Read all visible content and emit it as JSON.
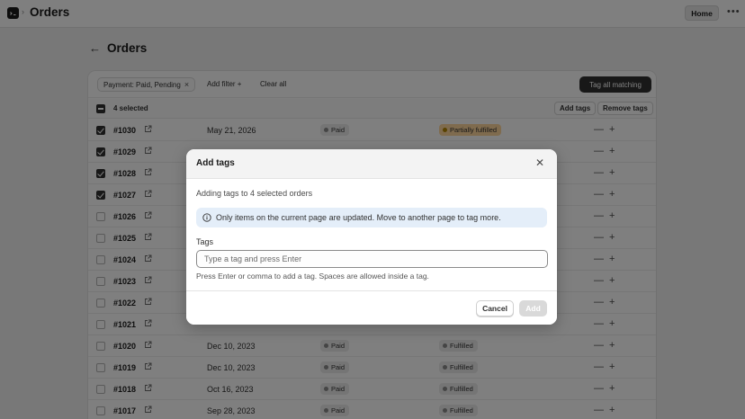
{
  "topbar": {
    "title": "Orders",
    "home_label": "Home",
    "more_icon": "more-horizontal-icon"
  },
  "page": {
    "title": "Orders"
  },
  "filters": {
    "chip_label": "Payment: Paid, Pending",
    "add_filter_label": "Add filter +",
    "clear_all_label": "Clear all",
    "tag_all_label": "Tag all matching"
  },
  "bulk": {
    "selected_label": "4 selected",
    "add_tags_label": "Add tags",
    "remove_tags_label": "Remove tags"
  },
  "orders": [
    {
      "number": "#1030",
      "date": "May 21, 2026",
      "payment": "Paid",
      "fulfillment": "Partially fulfilled",
      "checked": true,
      "partial": true
    },
    {
      "number": "#1029",
      "date": "",
      "payment": "",
      "fulfillment": "",
      "checked": true,
      "partial": true
    },
    {
      "number": "#1028",
      "date": "",
      "payment": "",
      "fulfillment": "",
      "checked": true,
      "partial": false
    },
    {
      "number": "#1027",
      "date": "",
      "payment": "",
      "fulfillment": "",
      "checked": true,
      "partial": false
    },
    {
      "number": "#1026",
      "date": "",
      "payment": "",
      "fulfillment": "",
      "checked": false,
      "partial": false
    },
    {
      "number": "#1025",
      "date": "",
      "payment": "",
      "fulfillment": "",
      "checked": false,
      "partial": false
    },
    {
      "number": "#1024",
      "date": "",
      "payment": "",
      "fulfillment": "",
      "checked": false,
      "partial": false
    },
    {
      "number": "#1023",
      "date": "",
      "payment": "",
      "fulfillment": "",
      "checked": false,
      "partial": false
    },
    {
      "number": "#1022",
      "date": "",
      "payment": "",
      "fulfillment": "",
      "checked": false,
      "partial": false
    },
    {
      "number": "#1021",
      "date": "",
      "payment": "",
      "fulfillment": "",
      "checked": false,
      "partial": false
    },
    {
      "number": "#1020",
      "date": "Dec 10, 2023",
      "payment": "Paid",
      "fulfillment": "Fulfilled",
      "checked": false,
      "partial": false
    },
    {
      "number": "#1019",
      "date": "Dec 10, 2023",
      "payment": "Paid",
      "fulfillment": "Fulfilled",
      "checked": false,
      "partial": false
    },
    {
      "number": "#1018",
      "date": "Oct 16, 2023",
      "payment": "Paid",
      "fulfillment": "Fulfilled",
      "checked": false,
      "partial": false
    },
    {
      "number": "#1017",
      "date": "Sep 28, 2023",
      "payment": "Paid",
      "fulfillment": "Fulfilled",
      "checked": false,
      "partial": false
    }
  ],
  "modal": {
    "title": "Add tags",
    "description": "Adding tags to 4 selected orders",
    "info_text": "Only items on the current page are updated. Move to another page to tag more.",
    "field_label": "Tags",
    "input_placeholder": "Type a tag and press Enter",
    "input_value": "",
    "help_text": "Press Enter or comma to add a tag. Spaces are allowed inside a tag.",
    "cancel_label": "Cancel",
    "add_label": "Add"
  },
  "colors": {
    "primary_dark": "#303030",
    "info_bg": "#e4eef9",
    "partial_badge_bg": "#ffd79d",
    "overlay": "rgba(0,0,0,0.5)"
  }
}
